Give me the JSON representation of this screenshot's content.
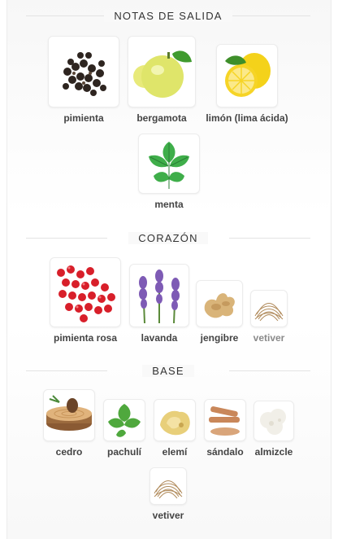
{
  "sections": {
    "top": {
      "title": "NOTAS DE SALIDA"
    },
    "heart": {
      "title": "CORAZÓN"
    },
    "base": {
      "title": "BASE"
    }
  },
  "notes": {
    "pimienta": "pimienta",
    "bergamota": "bergamota",
    "limon": "limón (lima ácida)",
    "menta": "menta",
    "pimienta_rosa": "pimienta rosa",
    "lavanda": "lavanda",
    "jengibre": "jengibre",
    "vetiver_heart": "vetiver",
    "cedro": "cedro",
    "pachuli": "pachulí",
    "elemi": "elemí",
    "sandalo": "sándalo",
    "almizcle": "almizcle",
    "vetiver_base": "vetiver"
  }
}
